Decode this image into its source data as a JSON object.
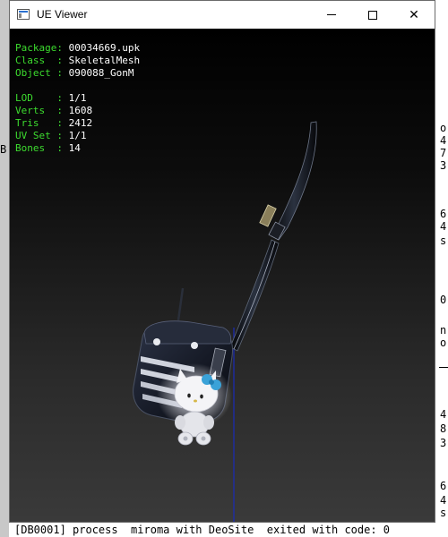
{
  "window": {
    "title": "UE Viewer",
    "controls": {
      "minimize": "minimize",
      "maximize": "maximize",
      "close": "✕"
    }
  },
  "viewer": {
    "package": {
      "key": "Package:",
      "value": "00034669.upk"
    },
    "class": {
      "key": "Class  :",
      "value": "SkeletalMesh"
    },
    "object": {
      "key": "Object :",
      "value": "090088_GonM"
    },
    "lod": {
      "key": "LOD    :",
      "value": "1/1"
    },
    "verts": {
      "key": "Verts  :",
      "value": "1608"
    },
    "tris": {
      "key": "Tris   :",
      "value": "2412"
    },
    "uvset": {
      "key": "UV Set :",
      "value": "1/1"
    },
    "bones": {
      "key": "Bones  :",
      "value": "14"
    }
  },
  "background_console": {
    "lines": [
      "o",
      "4",
      "7",
      "3",
      "6",
      "4",
      "s",
      "0",
      "n",
      "o",
      "4",
      "8",
      "3",
      "6",
      "4",
      "s"
    ],
    "bottom_text": "[DB0001] process  miroma with DeoSite  exited with code: 0",
    "left_glyph": "B"
  },
  "colors": {
    "label": "#3ddc2f",
    "value": "#ffffff",
    "bone_line": "#1a2bb8"
  }
}
